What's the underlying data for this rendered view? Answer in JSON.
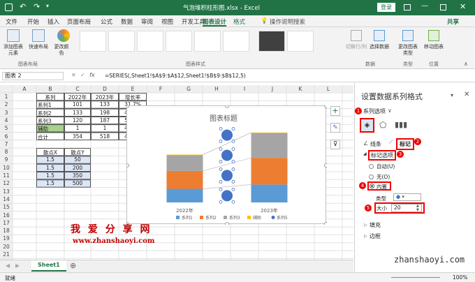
{
  "window": {
    "title": "气泡堆积柱形图.xlsx - Excel",
    "login": "登录"
  },
  "ribbon": {
    "tabs": [
      "文件",
      "开始",
      "插入",
      "页面布局",
      "公式",
      "数据",
      "审阅",
      "视图",
      "开发工具",
      "图表设计",
      "格式"
    ],
    "active_tab": "图表设计",
    "search": "操作说明搜索",
    "share": "共享",
    "buttons": {
      "add_element": "添加图表元素",
      "quick_layout": "快速布局",
      "change_color": "更改颜色",
      "switch_rowcol": "切换行/列",
      "select_data": "选择数据",
      "change_type": "更改图表类型",
      "move_chart": "移动图表"
    },
    "groups": {
      "layout": "图表布局",
      "styles": "图表样式",
      "data": "数据",
      "type": "类型",
      "location": "位置"
    }
  },
  "formula": {
    "namebox": "图表 2",
    "fx": "fx",
    "value": "=SERIES(,Sheet1!$A$9:$A$12,Sheet1!$B$9:$B$12,5)"
  },
  "grid": {
    "col_headers": [
      "A",
      "B",
      "C",
      "D",
      "E",
      "F",
      "G",
      "H",
      "I",
      "J",
      "K",
      "L"
    ],
    "row_headers": [
      "1",
      "2",
      "3",
      "4",
      "5",
      "6",
      "7",
      "8",
      "9",
      "10",
      "11",
      "12",
      "13",
      "14",
      "15",
      "16",
      "17",
      "18",
      "19",
      "20",
      "21"
    ],
    "table1": {
      "header": [
        "系列",
        "2022年",
        "2023年",
        "增长率"
      ],
      "rows": [
        [
          "系列1",
          "101",
          "133",
          "31.7%"
        ],
        [
          "系列2",
          "133",
          "198",
          "48.9%"
        ],
        [
          "系列3",
          "120",
          "187",
          "55.8%"
        ],
        [
          "辅助",
          "1",
          "1",
          "46.3%"
        ],
        [
          "合计",
          "354",
          "518",
          "46.3%"
        ]
      ]
    },
    "table2": {
      "header": [
        "散点X",
        "散点Y"
      ],
      "rows": [
        [
          "1.5",
          "50"
        ],
        [
          "1.5",
          "200"
        ],
        [
          "1.5",
          "350"
        ],
        [
          "1.5",
          "500"
        ]
      ]
    }
  },
  "chart_data": {
    "type": "bar",
    "title": "图表标题",
    "categories": [
      "2022年",
      "2023年"
    ],
    "stacked": true,
    "series": [
      {
        "name": "系列1",
        "values": [
          101,
          133
        ],
        "color": "#5b9bd5"
      },
      {
        "name": "系列2",
        "values": [
          133,
          198
        ],
        "color": "#ed7d31"
      },
      {
        "name": "系列3",
        "values": [
          120,
          187
        ],
        "color": "#a5a5a5"
      },
      {
        "name": "辅助",
        "values": [
          1,
          1
        ],
        "color": "#ffc000"
      },
      {
        "name": "系列5",
        "type": "scatter",
        "x": [
          1.5,
          1.5,
          1.5,
          1.5
        ],
        "y": [
          50,
          200,
          350,
          500
        ],
        "color": "#4472c4"
      }
    ],
    "grid": false,
    "legend_position": "bottom"
  },
  "pane": {
    "title": "设置数据系列格式",
    "options_label": "系列选项",
    "tab_line": "线条",
    "tab_marker": "标记",
    "marker_options": "标记选项",
    "auto": "自动(U)",
    "none": "无(O)",
    "builtin": "内置",
    "type_label": "类型",
    "size_label": "大小",
    "size_value": "20",
    "fill": "填充",
    "border": "边框",
    "steps": [
      "1",
      "2",
      "3",
      "4",
      "5"
    ]
  },
  "sheet": {
    "tab": "Sheet1"
  },
  "status": {
    "ready": "就绪",
    "zoom": "100%"
  },
  "watermark": {
    "cn": "我 爱 分 享 网",
    "url": "www.zhanshaoyi.com",
    "url2": "zhanshaoyi.com"
  }
}
